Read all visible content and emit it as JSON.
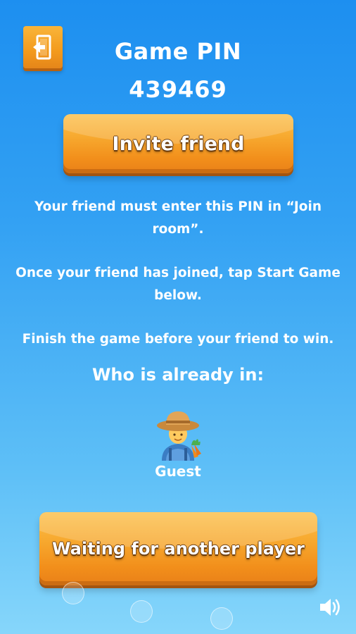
{
  "header": {
    "exit_icon": "exit-door-icon",
    "pin_title": "Game PIN",
    "pin_value": "439469"
  },
  "invite": {
    "label": "Invite friend"
  },
  "instructions": {
    "line1": "Your friend must enter this PIN in “Join room”.",
    "line2": "Once your friend has joined, tap Start Game below.",
    "line3": "Finish the game before your friend to win."
  },
  "players": {
    "heading": "Who is already in:",
    "list": [
      {
        "name": "Guest",
        "avatar": "farmer-emoji-icon"
      }
    ]
  },
  "waiting": {
    "label": "Waiting for another player"
  },
  "footer": {
    "sound_icon": "speaker-icon"
  },
  "colors": {
    "background_top": "#1d8ff0",
    "background_bottom": "#86d6fb",
    "button_orange": "#f7a82e",
    "button_shadow": "#a35510",
    "text": "#ffffff"
  }
}
